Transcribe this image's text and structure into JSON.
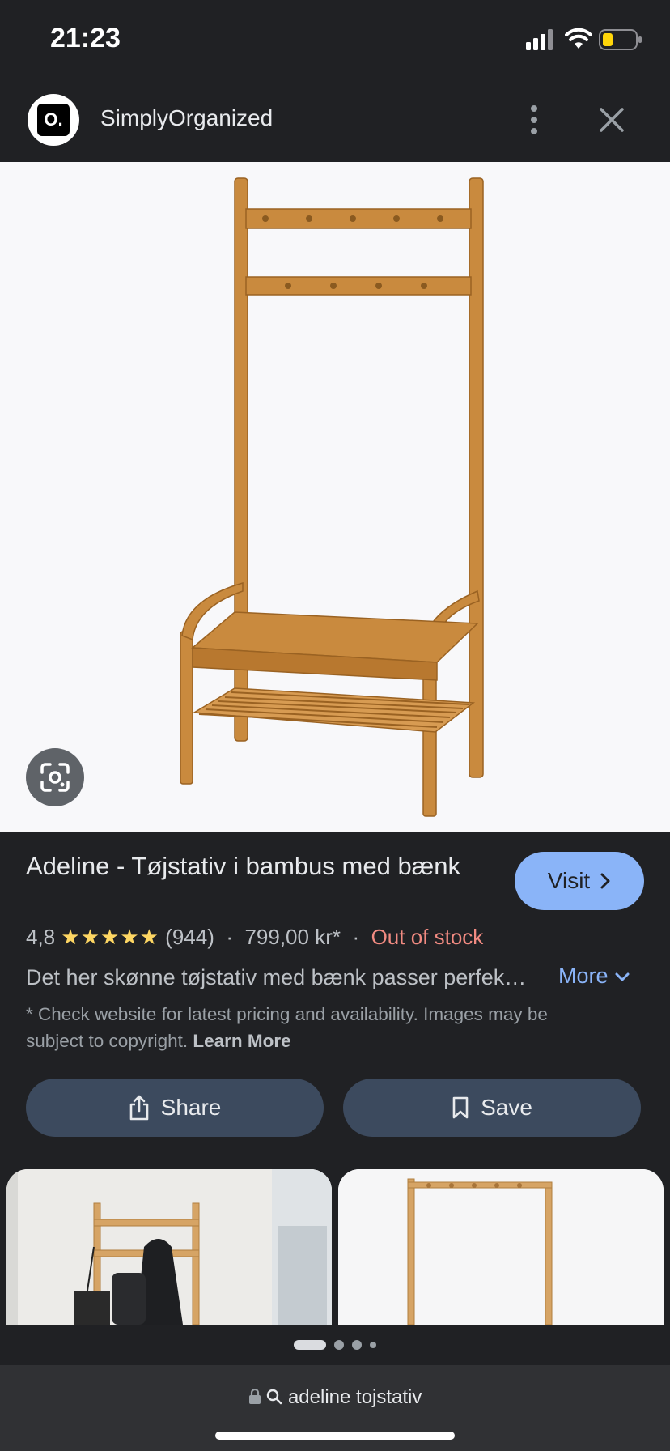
{
  "status_bar": {
    "time": "21:23"
  },
  "header": {
    "logo_text": "O.",
    "site_name": "SimplyOrganized"
  },
  "product": {
    "title": "Adeline - Tøjstativ i bambus med bænk",
    "visit_label": "Visit",
    "rating": "4,8",
    "stars": "★★★★★",
    "review_count": "(944)",
    "separator": "·",
    "price": "799,00 kr*",
    "stock_status": "Out of stock",
    "description": "Det her skønne tøjstativ med bænk passer perfek…",
    "more_label": "More",
    "disclaimer": "* Check website for latest pricing and availability. Images may be subject to copyright.",
    "learn_more_label": "Learn More"
  },
  "actions": {
    "share_label": "Share",
    "save_label": "Save"
  },
  "address_bar": {
    "query": "adeline tojstativ"
  },
  "colors": {
    "accent": "#8ab4f8",
    "stars": "#fdd663",
    "out_of_stock": "#f28b82",
    "button_bg": "#3c4a5e",
    "bamboo": "#c98a3e"
  }
}
